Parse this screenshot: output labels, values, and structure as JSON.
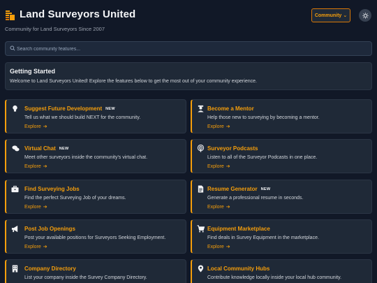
{
  "header": {
    "title": "Land Surveyors United",
    "tagline": "Community for Land Surveyors Since 2007",
    "community_button": "Community",
    "accent": "#f59e0b"
  },
  "search": {
    "placeholder": "Search community features..."
  },
  "intro": {
    "title": "Getting Started",
    "text": "Welcome to Land Surveyors United! Explore the features below to get the most out of your community experience."
  },
  "explore_label": "Explore",
  "cards": [
    {
      "title": "Suggest Future Development",
      "badge": "NEW",
      "desc": "Tell us what we should build NEXT for the community.",
      "icon": "lightbulb-icon"
    },
    {
      "title": "Become a Mentor",
      "badge": "",
      "desc": "Help those new to surveying by becoming a mentor.",
      "icon": "mentor-icon"
    },
    {
      "title": "Virtual Chat",
      "badge": "NEW",
      "desc": "Meet other surveyors inside the community's virtual chat.",
      "icon": "chat-icon"
    },
    {
      "title": "Surveyor Podcasts",
      "badge": "",
      "desc": "Listen to all of the Surveyor Podcasts in one place.",
      "icon": "podcast-icon"
    },
    {
      "title": "Find Surveying Jobs",
      "badge": "",
      "desc": "Find the perfect Surveying Job of your dreams.",
      "icon": "briefcase-icon"
    },
    {
      "title": "Resume Generator",
      "badge": "NEW",
      "desc": "Generate a professional resume in seconds.",
      "icon": "document-icon"
    },
    {
      "title": "Post Job Openings",
      "badge": "",
      "desc": "Post your available positions for Surveyors Seeking Employment.",
      "icon": "megaphone-icon"
    },
    {
      "title": "Equipment Marketplace",
      "badge": "",
      "desc": "Find deals in Survey Equipment in the marketplace.",
      "icon": "cart-icon"
    },
    {
      "title": "Company Directory",
      "badge": "",
      "desc": "List your company inside the Survey Company Directory.",
      "icon": "building-icon"
    },
    {
      "title": "Local Community Hubs",
      "badge": "",
      "desc": "Contribute knowledge locally inside your local hub community.",
      "icon": "location-pin-icon"
    }
  ]
}
